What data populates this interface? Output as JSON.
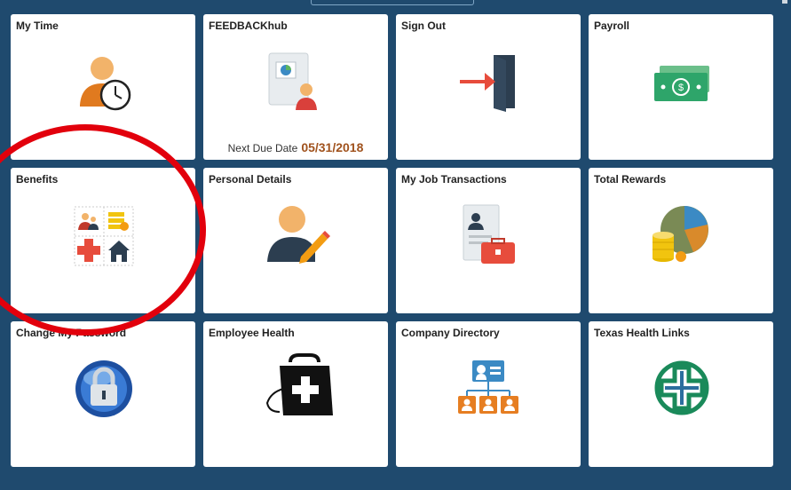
{
  "tiles": [
    {
      "title": "My Time",
      "icon": "person-clock-icon"
    },
    {
      "title": "FEEDBACKhub",
      "icon": "report-person-icon",
      "due_label": "Next Due Date",
      "due_date": "05/31/2018"
    },
    {
      "title": "Sign Out",
      "icon": "exit-door-icon"
    },
    {
      "title": "Payroll",
      "icon": "money-icon"
    },
    {
      "title": "Benefits",
      "icon": "benefits-grid-icon"
    },
    {
      "title": "Personal Details",
      "icon": "person-pencil-icon"
    },
    {
      "title": "My Job Transactions",
      "icon": "document-briefcase-icon"
    },
    {
      "title": "Total Rewards",
      "icon": "pie-coins-icon"
    },
    {
      "title": "Change My Password",
      "icon": "lock-globe-icon"
    },
    {
      "title": "Employee Health",
      "icon": "medical-bag-icon"
    },
    {
      "title": "Company Directory",
      "icon": "org-chart-icon"
    },
    {
      "title": "Texas Health Links",
      "icon": "health-cross-logo-icon"
    }
  ],
  "colors": {
    "background": "#1f4a6e",
    "highlight": "#e2000c",
    "due_date": "#a0521d"
  }
}
